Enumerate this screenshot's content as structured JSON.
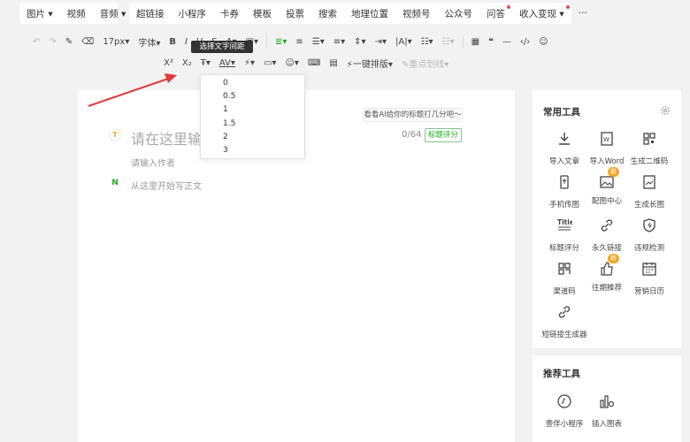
{
  "top_menu": {
    "group1": [
      {
        "label": "图片",
        "has_dropdown": true
      },
      {
        "label": "视频",
        "has_dropdown": false
      },
      {
        "label": "音频",
        "has_dropdown": true
      }
    ],
    "group2": [
      {
        "label": "超链接",
        "dot": false
      },
      {
        "label": "小程序",
        "dot": false
      },
      {
        "label": "卡券",
        "dot": false
      },
      {
        "label": "模板",
        "dot": false
      },
      {
        "label": "投票",
        "dot": false
      },
      {
        "label": "搜索",
        "dot": false
      },
      {
        "label": "地理位置",
        "dot": false
      },
      {
        "label": "视频号",
        "dot": false
      },
      {
        "label": "公众号",
        "dot": false
      },
      {
        "label": "问答",
        "dot": true
      },
      {
        "label": "收入变现",
        "dot": true
      },
      {
        "label": "···",
        "dot": false
      }
    ]
  },
  "toolbar": {
    "font_size": "17px",
    "font_family": "字体",
    "superscript": "X²",
    "subscript": "X₂",
    "letter_spacing": "AV",
    "one_click_layout": "一键排版",
    "divider_label": "重点划线"
  },
  "tooltip": {
    "text": "选择文字间距"
  },
  "letter_spacing_options": [
    "0",
    "0.5",
    "1",
    "1.5",
    "2",
    "3"
  ],
  "editor": {
    "title_placeholder": "请在这里输",
    "title_counter": "0/64",
    "title_score_button": "标题评分",
    "ai_hint": "看看AI给你的标题打几分吧～",
    "author_placeholder": "请输入作者",
    "body_placeholder": "从这里开始写正文",
    "title_badge": "T",
    "body_badge": "N"
  },
  "common_tools": {
    "title": "常用工具",
    "items": [
      {
        "label": "导入文章",
        "icon": "import-icon",
        "new": false
      },
      {
        "label": "导入Word",
        "icon": "word-icon",
        "new": false
      },
      {
        "label": "生成二维码",
        "icon": "qrcode-icon",
        "new": false
      },
      {
        "label": "手机传图",
        "icon": "phone-upload-icon",
        "new": false
      },
      {
        "label": "配图中心",
        "icon": "image-center-icon",
        "new": true
      },
      {
        "label": "生成长图",
        "icon": "long-image-icon",
        "new": false
      },
      {
        "label": "标题评分",
        "icon": "title-score-icon",
        "new": false
      },
      {
        "label": "永久链接",
        "icon": "link-icon",
        "new": false
      },
      {
        "label": "违规检测",
        "icon": "shield-icon",
        "new": false
      },
      {
        "label": "渠道码",
        "icon": "channel-code-icon",
        "new": false
      },
      {
        "label": "往期推荐",
        "icon": "thumbs-up-icon",
        "new": true
      },
      {
        "label": "营销日历",
        "icon": "calendar-icon",
        "new": false
      },
      {
        "label": "短链接生成器",
        "icon": "short-link-icon",
        "new": false
      }
    ],
    "new_badge": "新"
  },
  "recommended_tools": {
    "title": "推荐工具",
    "items": [
      {
        "label": "壹伴小程序",
        "icon": "mini-program-icon"
      },
      {
        "label": "插入图表",
        "icon": "chart-icon"
      }
    ]
  },
  "colors": {
    "accent_green": "#1aad19",
    "new_badge": "#f5a623",
    "arrow": "#e03a3a",
    "red_dot": "#e84a4a"
  }
}
